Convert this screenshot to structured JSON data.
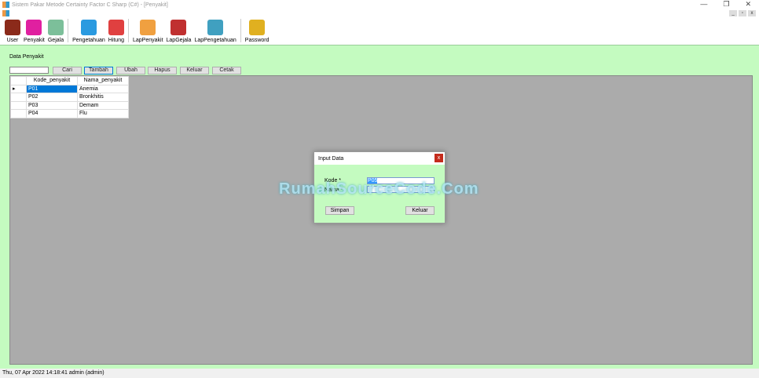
{
  "window": {
    "title": "Sistem Pakar Metode Certainty Factor C Sharp (C#) - [Penyakit]",
    "minimize": "—",
    "maximize": "❐",
    "close": "✕"
  },
  "mdi": {
    "minimize": "_",
    "restore": "▫",
    "close": "x"
  },
  "toolbar": [
    {
      "label": "User",
      "icon": "user-icon",
      "color": "#8b2a1a"
    },
    {
      "label": "Penyakit",
      "icon": "virus-icon",
      "color": "#e020a0"
    },
    {
      "label": "Gejala",
      "icon": "atom-icon",
      "color": "#7cbf9a"
    },
    {
      "label": "Pengetahuan",
      "icon": "arrows-in-icon",
      "color": "#2a9ae0"
    },
    {
      "label": "Hitung",
      "icon": "numbers-icon",
      "color": "#e04040"
    },
    {
      "label": "LapPenyakit",
      "icon": "report-icon",
      "color": "#f0a040"
    },
    {
      "label": "LapGejala",
      "icon": "magnifier-icon",
      "color": "#c03030"
    },
    {
      "label": "LapPengetahuan",
      "icon": "network-icon",
      "color": "#40a0c0"
    },
    {
      "label": "Password",
      "icon": "key-icon",
      "color": "#e0b020"
    }
  ],
  "page": {
    "label": "Data Penyakit",
    "search_value": "",
    "buttons": {
      "cari": "Cari",
      "tambah": "Tambah",
      "ubah": "Ubah",
      "hapus": "Hapus",
      "keluar": "Keluar",
      "cetak": "Cetak"
    }
  },
  "table": {
    "columns": [
      "Kode_penyakit",
      "Nama_penyakit"
    ],
    "rows": [
      [
        "P01",
        "Anemia"
      ],
      [
        "P02",
        "Bronkhitis"
      ],
      [
        "P03",
        "Demam"
      ],
      [
        "P04",
        "Flu"
      ]
    ]
  },
  "dialog": {
    "title": "Input Data",
    "kode_label": "Kode *",
    "kode_value": "P05",
    "nama_label": "Nama *",
    "nama_value": "",
    "simpan": "Simpan",
    "keluar": "Keluar",
    "close": "x"
  },
  "watermark": "RumahSourceCode.Com",
  "status": "Thu, 07 Apr 2022 14:18:41  admin (admin)"
}
